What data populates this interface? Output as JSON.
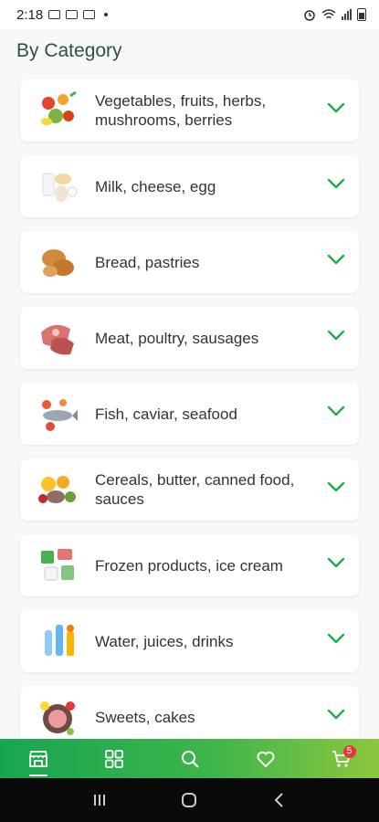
{
  "status_bar": {
    "time": "2:18"
  },
  "section_title": "By Category",
  "categories": [
    {
      "label": "Vegetables, fruits, herbs, mushrooms, berries",
      "icon": "vegetables-icon"
    },
    {
      "label": "Milk, cheese, egg",
      "icon": "dairy-icon"
    },
    {
      "label": "Bread, pastries",
      "icon": "bread-icon"
    },
    {
      "label": "Meat, poultry, sausages",
      "icon": "meat-icon"
    },
    {
      "label": "Fish, caviar, seafood",
      "icon": "fish-icon"
    },
    {
      "label": "Cereals, butter, canned food, sauces",
      "icon": "cereals-icon"
    },
    {
      "label": "Frozen products, ice cream",
      "icon": "frozen-icon"
    },
    {
      "label": "Water, juices, drinks",
      "icon": "drinks-icon"
    },
    {
      "label": "Sweets, cakes",
      "icon": "sweets-icon"
    }
  ],
  "bottom_nav": {
    "items": [
      "store-icon",
      "catalog-grid-icon",
      "search-icon",
      "heart-icon",
      "cart-icon"
    ],
    "cart_badge": "5"
  },
  "colors": {
    "accent": "#1faa4f",
    "badge": "#e53935"
  }
}
